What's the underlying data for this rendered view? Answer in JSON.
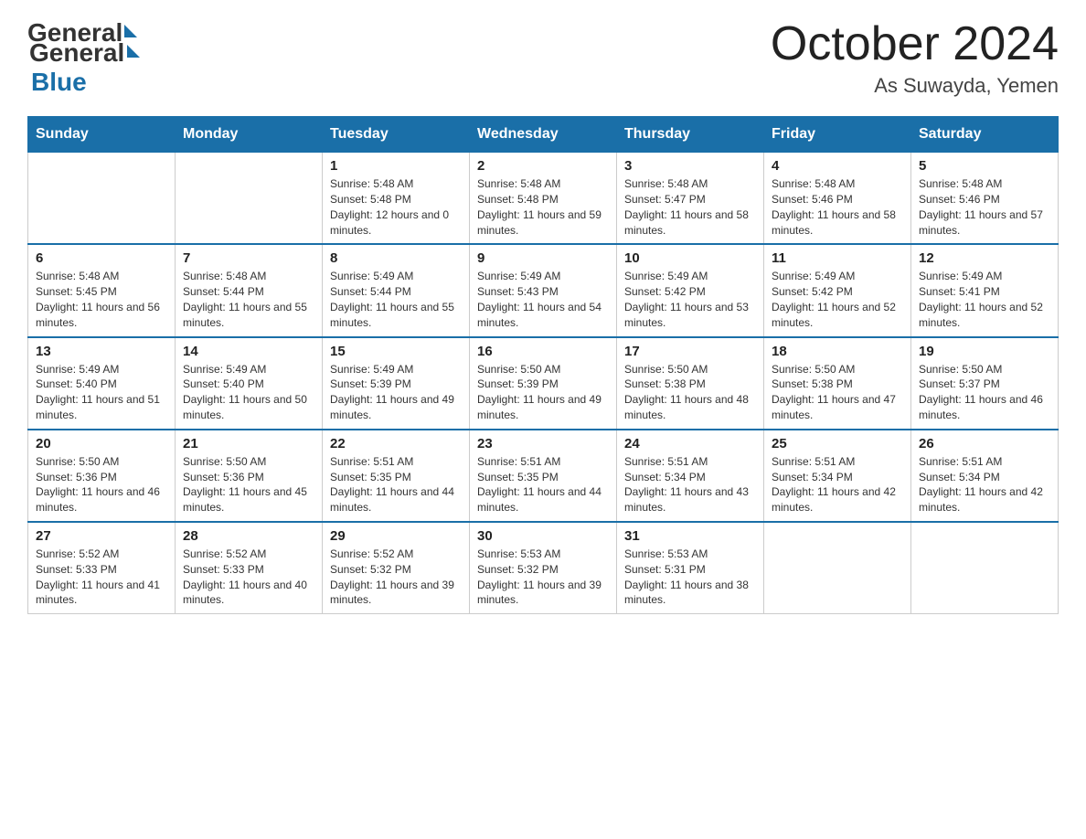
{
  "header": {
    "logo_general": "General",
    "logo_blue": "Blue",
    "month_title": "October 2024",
    "location": "As Suwayda, Yemen"
  },
  "days_of_week": [
    "Sunday",
    "Monday",
    "Tuesday",
    "Wednesday",
    "Thursday",
    "Friday",
    "Saturday"
  ],
  "weeks": [
    [
      {
        "day": "",
        "sunrise": "",
        "sunset": "",
        "daylight": ""
      },
      {
        "day": "",
        "sunrise": "",
        "sunset": "",
        "daylight": ""
      },
      {
        "day": "1",
        "sunrise": "Sunrise: 5:48 AM",
        "sunset": "Sunset: 5:48 PM",
        "daylight": "Daylight: 12 hours and 0 minutes."
      },
      {
        "day": "2",
        "sunrise": "Sunrise: 5:48 AM",
        "sunset": "Sunset: 5:48 PM",
        "daylight": "Daylight: 11 hours and 59 minutes."
      },
      {
        "day": "3",
        "sunrise": "Sunrise: 5:48 AM",
        "sunset": "Sunset: 5:47 PM",
        "daylight": "Daylight: 11 hours and 58 minutes."
      },
      {
        "day": "4",
        "sunrise": "Sunrise: 5:48 AM",
        "sunset": "Sunset: 5:46 PM",
        "daylight": "Daylight: 11 hours and 58 minutes."
      },
      {
        "day": "5",
        "sunrise": "Sunrise: 5:48 AM",
        "sunset": "Sunset: 5:46 PM",
        "daylight": "Daylight: 11 hours and 57 minutes."
      }
    ],
    [
      {
        "day": "6",
        "sunrise": "Sunrise: 5:48 AM",
        "sunset": "Sunset: 5:45 PM",
        "daylight": "Daylight: 11 hours and 56 minutes."
      },
      {
        "day": "7",
        "sunrise": "Sunrise: 5:48 AM",
        "sunset": "Sunset: 5:44 PM",
        "daylight": "Daylight: 11 hours and 55 minutes."
      },
      {
        "day": "8",
        "sunrise": "Sunrise: 5:49 AM",
        "sunset": "Sunset: 5:44 PM",
        "daylight": "Daylight: 11 hours and 55 minutes."
      },
      {
        "day": "9",
        "sunrise": "Sunrise: 5:49 AM",
        "sunset": "Sunset: 5:43 PM",
        "daylight": "Daylight: 11 hours and 54 minutes."
      },
      {
        "day": "10",
        "sunrise": "Sunrise: 5:49 AM",
        "sunset": "Sunset: 5:42 PM",
        "daylight": "Daylight: 11 hours and 53 minutes."
      },
      {
        "day": "11",
        "sunrise": "Sunrise: 5:49 AM",
        "sunset": "Sunset: 5:42 PM",
        "daylight": "Daylight: 11 hours and 52 minutes."
      },
      {
        "day": "12",
        "sunrise": "Sunrise: 5:49 AM",
        "sunset": "Sunset: 5:41 PM",
        "daylight": "Daylight: 11 hours and 52 minutes."
      }
    ],
    [
      {
        "day": "13",
        "sunrise": "Sunrise: 5:49 AM",
        "sunset": "Sunset: 5:40 PM",
        "daylight": "Daylight: 11 hours and 51 minutes."
      },
      {
        "day": "14",
        "sunrise": "Sunrise: 5:49 AM",
        "sunset": "Sunset: 5:40 PM",
        "daylight": "Daylight: 11 hours and 50 minutes."
      },
      {
        "day": "15",
        "sunrise": "Sunrise: 5:49 AM",
        "sunset": "Sunset: 5:39 PM",
        "daylight": "Daylight: 11 hours and 49 minutes."
      },
      {
        "day": "16",
        "sunrise": "Sunrise: 5:50 AM",
        "sunset": "Sunset: 5:39 PM",
        "daylight": "Daylight: 11 hours and 49 minutes."
      },
      {
        "day": "17",
        "sunrise": "Sunrise: 5:50 AM",
        "sunset": "Sunset: 5:38 PM",
        "daylight": "Daylight: 11 hours and 48 minutes."
      },
      {
        "day": "18",
        "sunrise": "Sunrise: 5:50 AM",
        "sunset": "Sunset: 5:38 PM",
        "daylight": "Daylight: 11 hours and 47 minutes."
      },
      {
        "day": "19",
        "sunrise": "Sunrise: 5:50 AM",
        "sunset": "Sunset: 5:37 PM",
        "daylight": "Daylight: 11 hours and 46 minutes."
      }
    ],
    [
      {
        "day": "20",
        "sunrise": "Sunrise: 5:50 AM",
        "sunset": "Sunset: 5:36 PM",
        "daylight": "Daylight: 11 hours and 46 minutes."
      },
      {
        "day": "21",
        "sunrise": "Sunrise: 5:50 AM",
        "sunset": "Sunset: 5:36 PM",
        "daylight": "Daylight: 11 hours and 45 minutes."
      },
      {
        "day": "22",
        "sunrise": "Sunrise: 5:51 AM",
        "sunset": "Sunset: 5:35 PM",
        "daylight": "Daylight: 11 hours and 44 minutes."
      },
      {
        "day": "23",
        "sunrise": "Sunrise: 5:51 AM",
        "sunset": "Sunset: 5:35 PM",
        "daylight": "Daylight: 11 hours and 44 minutes."
      },
      {
        "day": "24",
        "sunrise": "Sunrise: 5:51 AM",
        "sunset": "Sunset: 5:34 PM",
        "daylight": "Daylight: 11 hours and 43 minutes."
      },
      {
        "day": "25",
        "sunrise": "Sunrise: 5:51 AM",
        "sunset": "Sunset: 5:34 PM",
        "daylight": "Daylight: 11 hours and 42 minutes."
      },
      {
        "day": "26",
        "sunrise": "Sunrise: 5:51 AM",
        "sunset": "Sunset: 5:34 PM",
        "daylight": "Daylight: 11 hours and 42 minutes."
      }
    ],
    [
      {
        "day": "27",
        "sunrise": "Sunrise: 5:52 AM",
        "sunset": "Sunset: 5:33 PM",
        "daylight": "Daylight: 11 hours and 41 minutes."
      },
      {
        "day": "28",
        "sunrise": "Sunrise: 5:52 AM",
        "sunset": "Sunset: 5:33 PM",
        "daylight": "Daylight: 11 hours and 40 minutes."
      },
      {
        "day": "29",
        "sunrise": "Sunrise: 5:52 AM",
        "sunset": "Sunset: 5:32 PM",
        "daylight": "Daylight: 11 hours and 39 minutes."
      },
      {
        "day": "30",
        "sunrise": "Sunrise: 5:53 AM",
        "sunset": "Sunset: 5:32 PM",
        "daylight": "Daylight: 11 hours and 39 minutes."
      },
      {
        "day": "31",
        "sunrise": "Sunrise: 5:53 AM",
        "sunset": "Sunset: 5:31 PM",
        "daylight": "Daylight: 11 hours and 38 minutes."
      },
      {
        "day": "",
        "sunrise": "",
        "sunset": "",
        "daylight": ""
      },
      {
        "day": "",
        "sunrise": "",
        "sunset": "",
        "daylight": ""
      }
    ]
  ]
}
